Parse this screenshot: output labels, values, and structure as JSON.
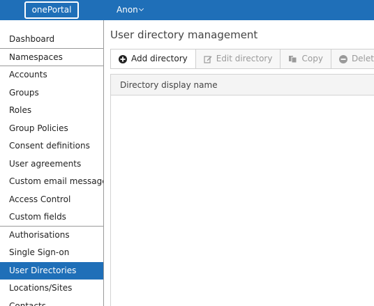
{
  "header": {
    "logo_text": "onePortal",
    "user_name": "Anon"
  },
  "sidebar": {
    "items": [
      {
        "label": "Dashboard"
      },
      {
        "label": "Namespaces"
      },
      {
        "label": "Accounts"
      },
      {
        "label": "Groups"
      },
      {
        "label": "Roles"
      },
      {
        "label": "Group Policies"
      },
      {
        "label": "Consent definitions"
      },
      {
        "label": "User agreements"
      },
      {
        "label": "Custom email messages"
      },
      {
        "label": "Access Control"
      },
      {
        "label": "Custom fields"
      },
      {
        "label": "Authorisations"
      },
      {
        "label": "Single Sign-on"
      },
      {
        "label": "User Directories"
      },
      {
        "label": "Locations/Sites"
      },
      {
        "label": "Contacts"
      }
    ],
    "active": "User Directories"
  },
  "main": {
    "title": "User directory management",
    "toolbar": {
      "add_label": "Add directory",
      "edit_label": "Edit directory",
      "copy_label": "Copy",
      "delete_label": "Delete directory"
    },
    "table": {
      "columns": [
        "Directory display name"
      ],
      "rows": []
    }
  },
  "colors": {
    "brand": "#1f6fb8",
    "active_bg": "#1f6fb8",
    "disabled_text": "#9a9a9a"
  }
}
